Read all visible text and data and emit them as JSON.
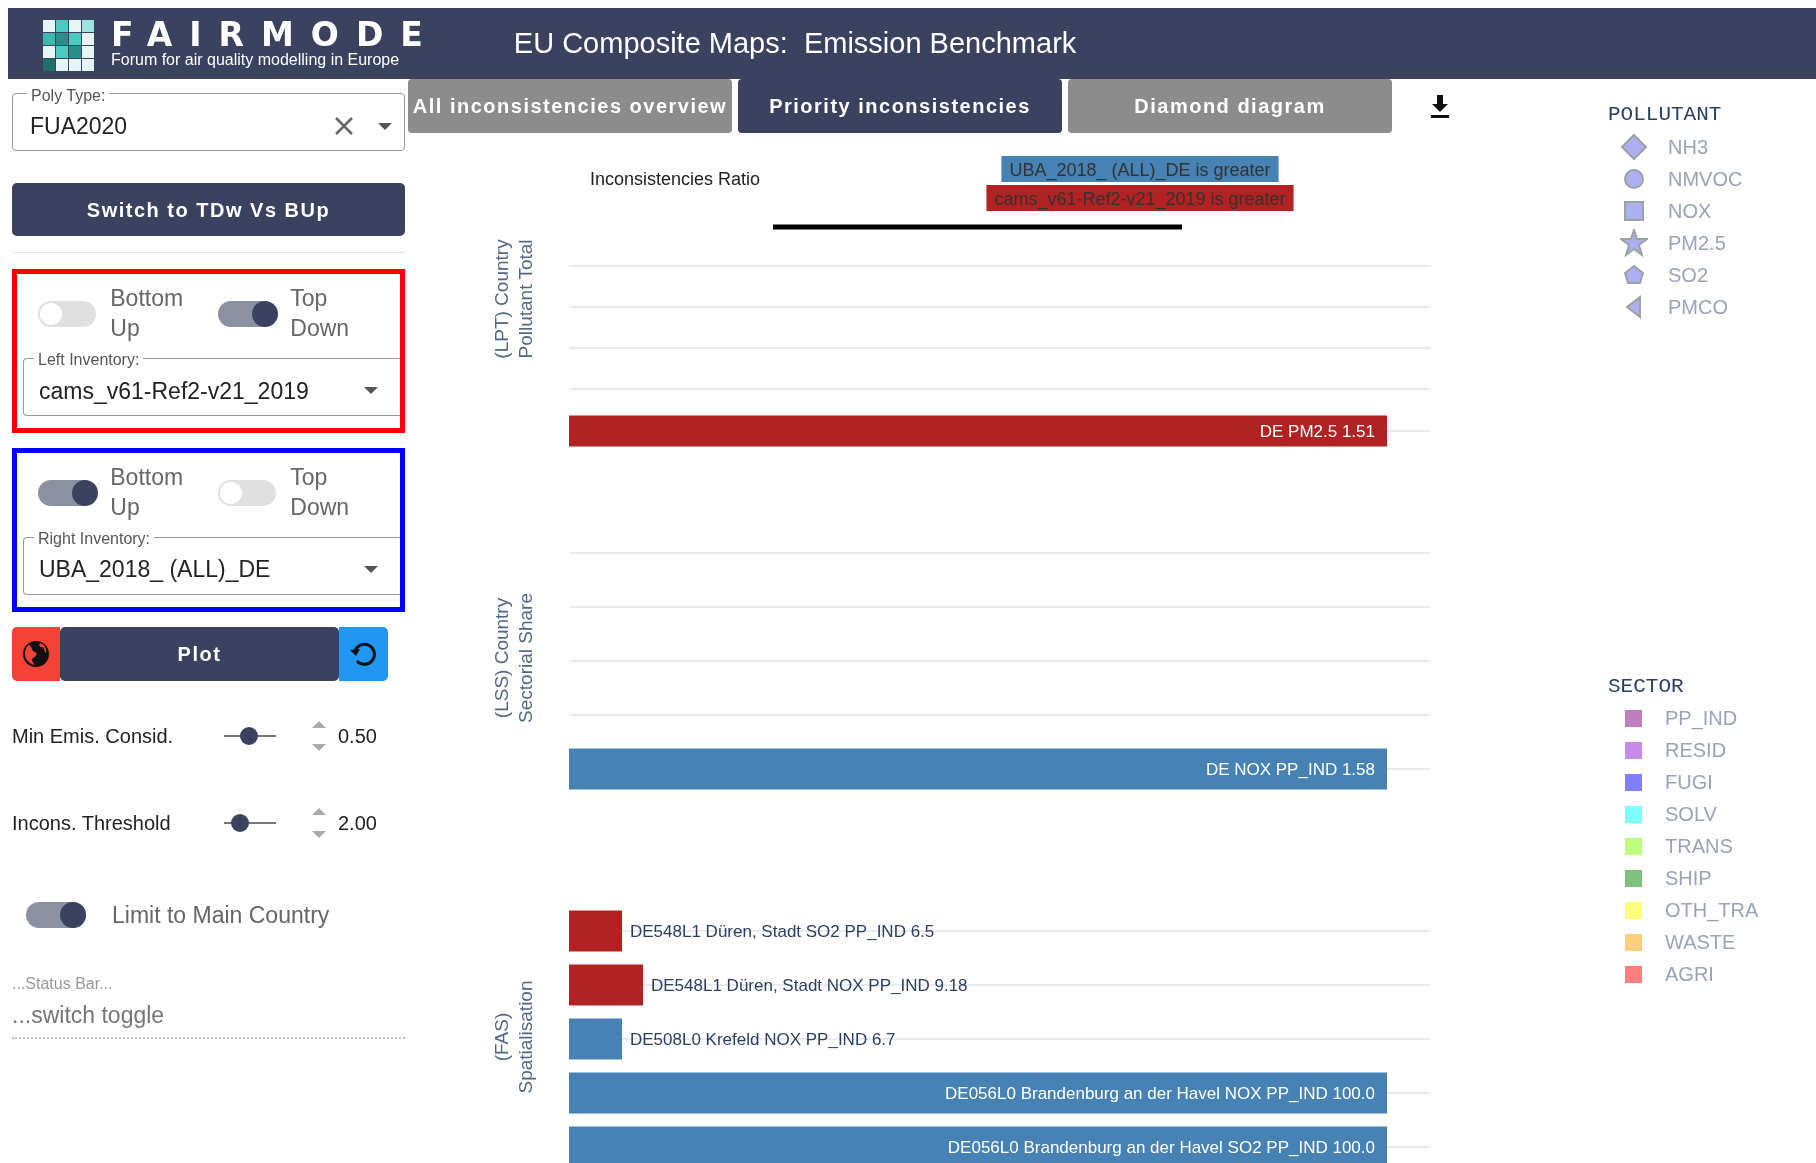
{
  "header": {
    "logo_title": "FAIRMODE",
    "logo_subtitle": "Forum for air quality modelling in Europe",
    "title": "EU Composite Maps:  Emission Benchmark"
  },
  "sidebar": {
    "poly_type": {
      "label": "Poly Type:",
      "value": "FUA2020"
    },
    "switch_button": "Switch to TDw Vs BUp",
    "inventories": [
      {
        "color": "#ff0000",
        "toggles": [
          {
            "label": "Bottom Up",
            "on": false
          },
          {
            "label": "Top Down",
            "on": true
          }
        ],
        "label": "Left Inventory:",
        "value": "cams_v61-Ref2-v21_2019"
      },
      {
        "color": "#0000ff",
        "toggles": [
          {
            "label": "Bottom Up",
            "on": true
          },
          {
            "label": "Top Down",
            "on": false
          }
        ],
        "label": "Right Inventory:",
        "value": "UBA_2018_ (ALL)_DE"
      }
    ],
    "plot_button": "Plot",
    "sliders": [
      {
        "label": "Min Emis. Consid.",
        "level": 0.48,
        "value": "0.50"
      },
      {
        "label": "Incons. Threshold",
        "level": 0.2,
        "value": "2.00"
      }
    ],
    "limit_toggle": {
      "label": "Limit to Main Country",
      "on": true
    },
    "status": {
      "label": "...Status Bar...",
      "placeholder": "...switch toggle"
    }
  },
  "tabs": [
    {
      "label": "All inconsistencies overview",
      "selected": false
    },
    {
      "label": "Priority inconsistencies",
      "selected": true
    },
    {
      "label": "Diamond diagram",
      "selected": false
    }
  ],
  "chart": {
    "title": "Inconsistencies Ratio",
    "legend": [
      {
        "label": "UBA_2018_ (ALL)_DE is greater",
        "color": "#4682b4"
      },
      {
        "label": "cams_v61-Ref2-v21_2019 is greater",
        "color": "#b22222"
      }
    ],
    "sections": [
      {
        "title": [
          "(LPT) Country",
          "Pollutant Total"
        ],
        "bars": [
          {
            "label": "DE PM2.5 1.51",
            "color": "#b22222",
            "kind": "full"
          }
        ]
      },
      {
        "title": [
          "(LSS) Country",
          "Sectorial Share"
        ],
        "bars": [
          {
            "label": "DE NOX PP_IND 1.58",
            "color": "#4682b4",
            "kind": "full"
          }
        ]
      },
      {
        "title": [
          "(FAS)",
          "Spatialisation"
        ],
        "bars": [
          {
            "label": "DE548L1 Düren, Stadt SO2 PP_IND 6.5",
            "color": "#b22222",
            "kind": "short"
          },
          {
            "label": "DE548L1 Düren, Stadt NOX PP_IND 9.18",
            "color": "#b22222",
            "kind": "short"
          },
          {
            "label": "DE508L0 Krefeld NOX PP_IND 6.7",
            "color": "#4682b4",
            "kind": "short"
          },
          {
            "label": "DE056L0 Brandenburg an der Havel NOX PP_IND 100.0",
            "color": "#4682b4",
            "kind": "full"
          },
          {
            "label": "DE056L0 Brandenburg an der Havel SO2 PP_IND 100.0",
            "color": "#4682b4",
            "kind": "full"
          }
        ]
      }
    ]
  },
  "legend": {
    "pollutant": {
      "title": "POLLUTANT",
      "items": [
        {
          "label": "NH3",
          "kind": "diamond"
        },
        {
          "label": "NMVOC",
          "kind": "circle"
        },
        {
          "label": "NOX",
          "kind": "square"
        },
        {
          "label": "PM2.5",
          "kind": "star"
        },
        {
          "label": "SO2",
          "kind": "pentagon"
        },
        {
          "label": "PMCO",
          "kind": "triangle"
        }
      ]
    },
    "sector": {
      "title": "SECTOR",
      "items": [
        {
          "label": "PP_IND",
          "color": "#bf7fbf"
        },
        {
          "label": "RESID",
          "color": "#c78ceb"
        },
        {
          "label": "FUGI",
          "color": "#7f7fff"
        },
        {
          "label": "SOLV",
          "color": "#7fffff"
        },
        {
          "label": "TRANS",
          "color": "#bfff7f"
        },
        {
          "label": "SHIP",
          "color": "#7fbf7f"
        },
        {
          "label": "OTH_TRA",
          "color": "#ffff7f"
        },
        {
          "label": "WASTE",
          "color": "#ffcf7f"
        },
        {
          "label": "AGRI",
          "color": "#ff7f7f"
        }
      ]
    }
  }
}
